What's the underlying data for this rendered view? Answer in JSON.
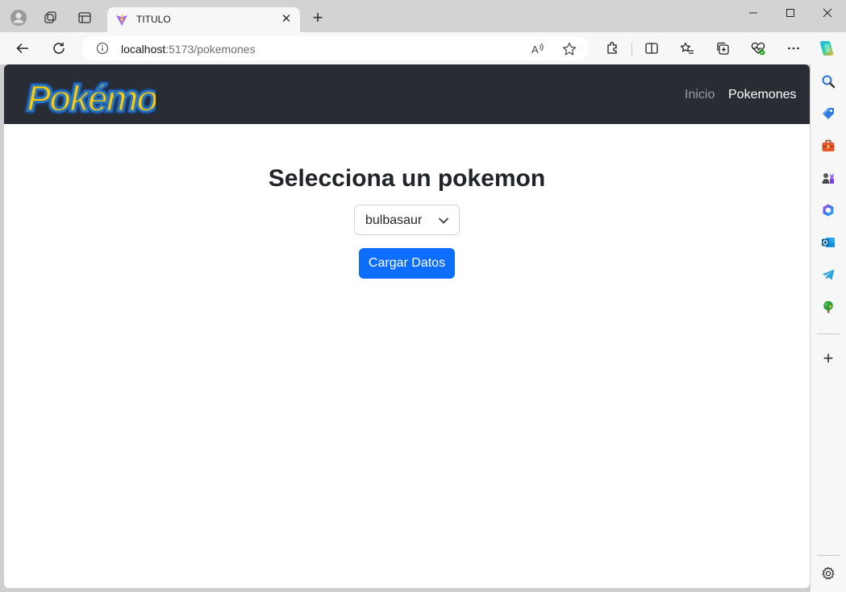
{
  "browser": {
    "tab": {
      "title": "TITULO"
    },
    "address": {
      "host": "localhost",
      "path": ":5173/pokemones"
    },
    "icons": {
      "profile": "profile-icon",
      "workspaces": "workspaces-icon",
      "tab_actions": "tab-actions-icon",
      "favicon": "vite-favicon-icon",
      "close_tab": "close-icon",
      "new_tab": "plus-icon",
      "back": "back-arrow-icon",
      "refresh": "refresh-icon",
      "site_info": "info-icon",
      "read_aloud": "read-aloud-icon",
      "favorite": "star-icon",
      "extensions": "extensions-icon",
      "split_screen": "split-screen-icon",
      "favorites": "favorites-icon",
      "collections": "collections-icon",
      "browser_essentials": "heart-pulse-icon",
      "more": "more-icon",
      "copilot": "copilot-icon"
    },
    "tab_close_glyph": "✕",
    "new_tab_glyph": "+"
  },
  "sidebar": {
    "items": [
      "search-icon",
      "shopping-tag-icon",
      "tools-briefcase-icon",
      "games-icon",
      "microsoft365-icon",
      "outlook-icon",
      "telegram-icon",
      "tree-icon"
    ],
    "add_glyph": "+"
  },
  "page": {
    "navbar": {
      "brand": "Pokémon",
      "links": [
        {
          "label": "Inicio",
          "active": false
        },
        {
          "label": "Pokemones",
          "active": true
        }
      ]
    },
    "heading": "Selecciona un pokemon",
    "select": {
      "value": "bulbasaur"
    },
    "button": {
      "label": "Cargar Datos"
    }
  },
  "colors": {
    "navbar_bg": "#292d33",
    "primary": "#0d6efd",
    "logo_yellow": "#ffcb05",
    "logo_blue": "#2a75bb"
  }
}
